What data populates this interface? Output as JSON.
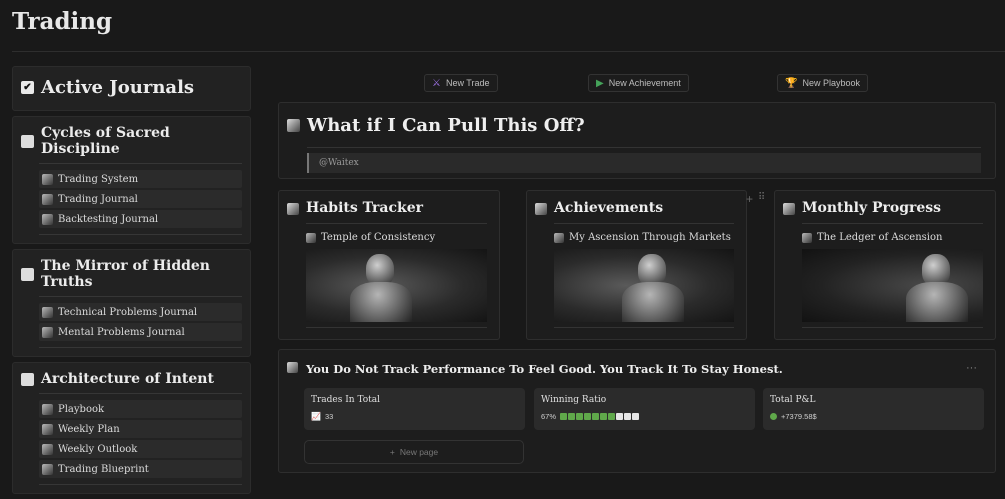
{
  "page": {
    "title": "Trading"
  },
  "sidebar": {
    "sections": [
      {
        "title": "Active Journals",
        "items": []
      },
      {
        "title": "Cycles of Sacred Discipline",
        "items": [
          "Trading System",
          "Trading Journal",
          "Backtesting Journal"
        ]
      },
      {
        "title": "The Mirror of Hidden Truths",
        "items": [
          "Technical Problems Journal",
          "Mental Problems Journal"
        ]
      },
      {
        "title": "Architecture of Intent",
        "items": [
          "Playbook",
          "Weekly Plan",
          "Weekly Outlook",
          "Trading Blueprint"
        ]
      }
    ]
  },
  "buttons": {
    "new_trade": "New Trade",
    "new_achievement": "New Achievement",
    "new_playbook": "New Playbook"
  },
  "hero": {
    "title": "What if I Can Pull This Off?",
    "quote": "@Waitex"
  },
  "cards": [
    {
      "title": "Habits Tracker",
      "link": "Temple of Consistency"
    },
    {
      "title": "Achievements",
      "link": "My Ascension Through Markets"
    },
    {
      "title": "Monthly Progress",
      "link": "The Ledger of Ascension"
    }
  ],
  "performance": {
    "title": "You Do Not Track Performance To Feel Good. You Track It To Stay Honest.",
    "stats": [
      {
        "label": "Trades In Total",
        "value": "33"
      },
      {
        "label": "Winning Ratio",
        "value": "67%"
      },
      {
        "label": "Total P&L",
        "value": "+7379.58$"
      }
    ],
    "win_filled": 7,
    "win_total": 10,
    "new_page": "New page"
  },
  "colors": {
    "green": "#5fa84a",
    "accent_purple": "#9b6fe0",
    "accent_green": "#45a35a",
    "accent_gold": "#e0a33a"
  }
}
